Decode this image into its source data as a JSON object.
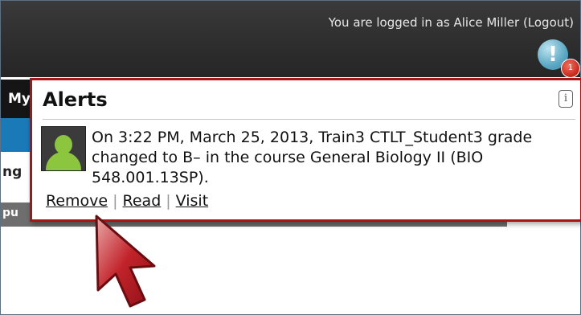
{
  "header": {
    "logged_in_text": "You are logged in as Alice Miller",
    "logout_label": "(Logout)",
    "alert_badge_symbol": "!",
    "alert_count": "1"
  },
  "background": {
    "nav_fragment": "My",
    "section_fragment": "ng",
    "band_fragment": "pu"
  },
  "alerts": {
    "title": "Alerts",
    "info_icon": "i",
    "items": [
      {
        "message": "On 3:22 PM, March 25, 2013, Train3 CTLT_Student3 grade changed to B– in the course General Biology II (BIO 548.001.13SP).",
        "actions": {
          "remove": "Remove",
          "read": "Read",
          "visit": "Visit",
          "separator": "|"
        }
      }
    ]
  },
  "colors": {
    "highlight_border": "#a81414",
    "topbar": "#2e2e2e",
    "nav_blue": "#1a7ab8",
    "avatar_green": "#8cc63f"
  }
}
